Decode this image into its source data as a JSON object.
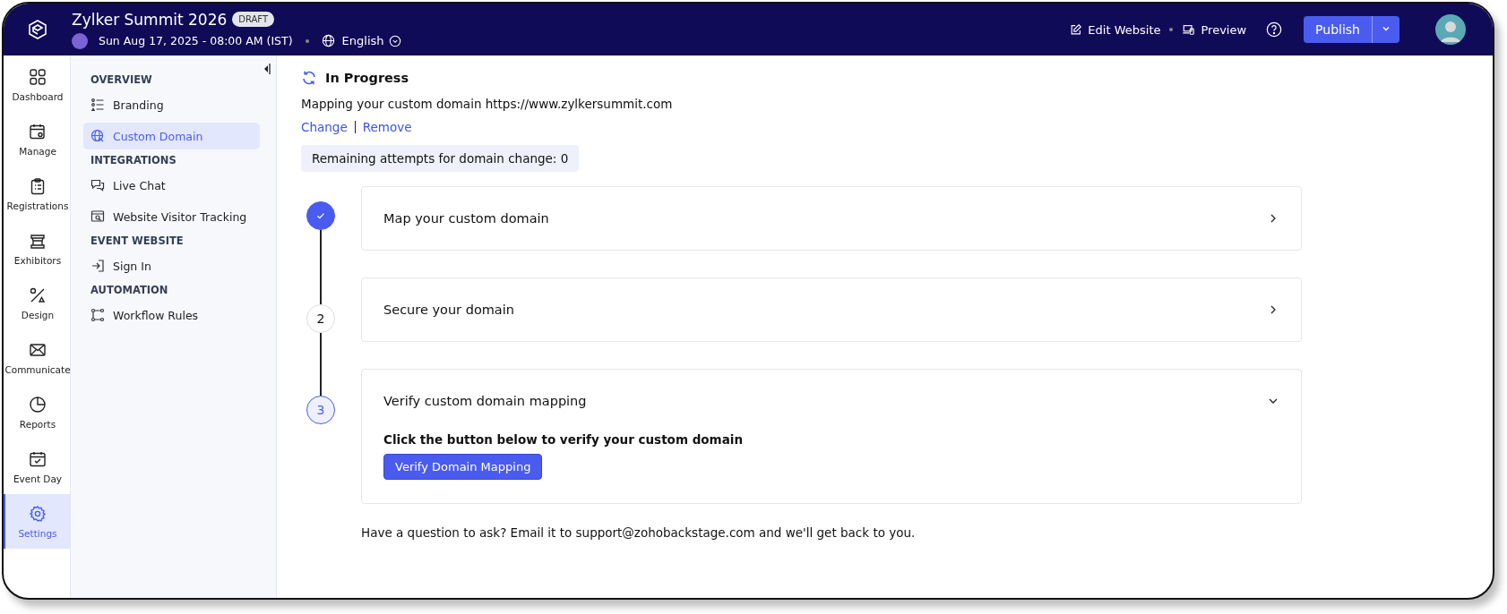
{
  "header": {
    "event_title": "Zylker Summit 2026",
    "status_badge": "DRAFT",
    "date": "Sun Aug 17, 2025 - 08:00 AM (IST)",
    "language": "English",
    "actions": [
      "Edit Website",
      "Preview"
    ],
    "publish_button": "Publish"
  },
  "rail": [
    {
      "label": "Dashboard",
      "selected": false
    },
    {
      "label": "Manage",
      "selected": false
    },
    {
      "label": "Registrations",
      "selected": false
    },
    {
      "label": "Exhibitors",
      "selected": false
    },
    {
      "label": "Design",
      "selected": false
    },
    {
      "label": "Communicate",
      "selected": false
    },
    {
      "label": "Reports",
      "selected": false
    },
    {
      "label": "Event Day",
      "selected": false
    },
    {
      "label": "Settings",
      "selected": true
    }
  ],
  "sidebar": {
    "sections": [
      {
        "title": "OVERVIEW",
        "items": [
          {
            "label": "Branding",
            "selected": false
          },
          {
            "label": "Custom Domain",
            "selected": true
          }
        ]
      },
      {
        "title": "INTEGRATIONS",
        "items": [
          {
            "label": "Live Chat",
            "selected": false
          },
          {
            "label": "Website Visitor Tracking",
            "selected": false
          }
        ]
      },
      {
        "title": "EVENT WEBSITE",
        "items": [
          {
            "label": "Sign In",
            "selected": false
          }
        ]
      },
      {
        "title": "AUTOMATION",
        "items": [
          {
            "label": "Workflow Rules",
            "selected": false
          }
        ]
      }
    ]
  },
  "main": {
    "status": "In Progress",
    "mapping_text": "Mapping your custom domain https://www.zylkersummit.com",
    "links": [
      "Change",
      "Remove"
    ],
    "attempts": "Remaining attempts for domain change: 0",
    "steps": [
      {
        "title": "Map your custom domain",
        "completed": true,
        "current": false,
        "expanded": false
      },
      {
        "number": "2",
        "title": "Secure your domain",
        "completed": false,
        "current": false,
        "expanded": false
      },
      {
        "number": "3",
        "title": "Verify custom domain mapping",
        "completed": false,
        "current": true,
        "expanded": true,
        "body": "Click the button below to verify your custom domain",
        "button": "Verify Domain Mapping"
      }
    ],
    "footer": "Have a question to ask? Email it to support@zohobackstage.com and we'll get back to you."
  }
}
